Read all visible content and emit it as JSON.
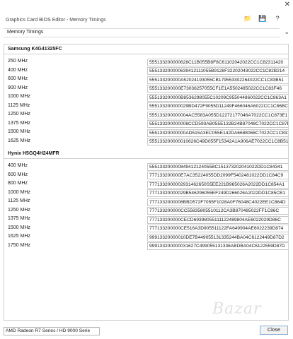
{
  "window": {
    "title": "Graphics Card BIOS Editor - Memory Timings",
    "close_glyph": "✕"
  },
  "toolbar": {
    "open_icon": "folder-icon",
    "save_icon": "save-icon",
    "help_icon": "question-icon"
  },
  "section_select": {
    "value": "Memory Timings",
    "chevron": "⌄"
  },
  "groups": [
    {
      "title": "Samsung K4G41325FC",
      "rows": [
        {
          "freq": "250 MHz",
          "timing": "555133200000628C11B055B8F8C61102042022CC1C82311420"
        },
        {
          "freq": "400 MHz",
          "timing": "555133200000639412111055B9128F32202043022CC1C82B214"
        },
        {
          "freq": "600 MHz",
          "timing": "555133200000A52024193055CB179553302264022CC1C83B51"
        },
        {
          "freq": "900 MHz",
          "timing": "555133200000E73036257055CF1E1A5502485022CC1C83F46"
        },
        {
          "freq": "1000 MHz",
          "timing": "555133200000B8536298055C10209C955044860022CC1C863A1"
        },
        {
          "freq": "1125 MHz",
          "timing": "555133200000029BD472F9055D11249F466046A6022CC1C86BC"
        },
        {
          "freq": "1250 MHz",
          "timing": "555133200000004AC5583A055D12272177046A7022CC1C873E1"
        },
        {
          "freq": "1375 MHz",
          "timing": "555133200000008CCD593AB055E132B24B87048C7022CC1C87B0"
        },
        {
          "freq": "1500 MHz",
          "timing": "55513320000000AD515A3EC055E142DA6688068C7022CC1C831"
        },
        {
          "freq": "1625 MHz",
          "timing": "555133200000010626C49D055F15342A1A906AE7022CC1C8B51"
        }
      ]
    },
    {
      "title": "Hynix H5GQ4H24MFR",
      "rows": [
        {
          "freq": "400 MHz",
          "timing": "555133200000849412124055BC151373202041022DD1C84341"
        },
        {
          "freq": "600 MHz",
          "timing": "777133200000E7AC35224055DD2099F5402481022DD1C84C9"
        },
        {
          "freq": "800 MHz",
          "timing": "7771332000002931462650S5EE221B965026A2022DD1C854A1"
        },
        {
          "freq": "1000 MHz",
          "timing": "77713320000029B546296055EF249D266026A2022DD1C85CB1"
        },
        {
          "freq": "1125 MHz",
          "timing": "7771332000006BBD572F7055F1028A0F76048C4022EE1C864D"
        },
        {
          "freq": "1250 MHz",
          "timing": "777133200000CC55835805510112CA3B870485022FF1C86C"
        },
        {
          "freq": "1375 MHz",
          "timing": "777133200000CECD69398055111122489804AE6022029D86C"
        },
        {
          "freq": "1500 MHz",
          "timing": "777133200000CE516A3D905511122FA649904AE6022239D874"
        },
        {
          "freq": "1625 MHz",
          "timing": "99913320000010DE7B449055131335244BA04C6122449D87D2"
        },
        {
          "freq": "1750 MHz",
          "timing": "999133200000031627C499055131336ABDBA04C6122559D87D"
        }
      ]
    }
  ],
  "footer": {
    "gpu_select": "AMD Radeon R7 Series / HD 9000 Serie",
    "close_label": "Close"
  },
  "watermark": "Bazar"
}
